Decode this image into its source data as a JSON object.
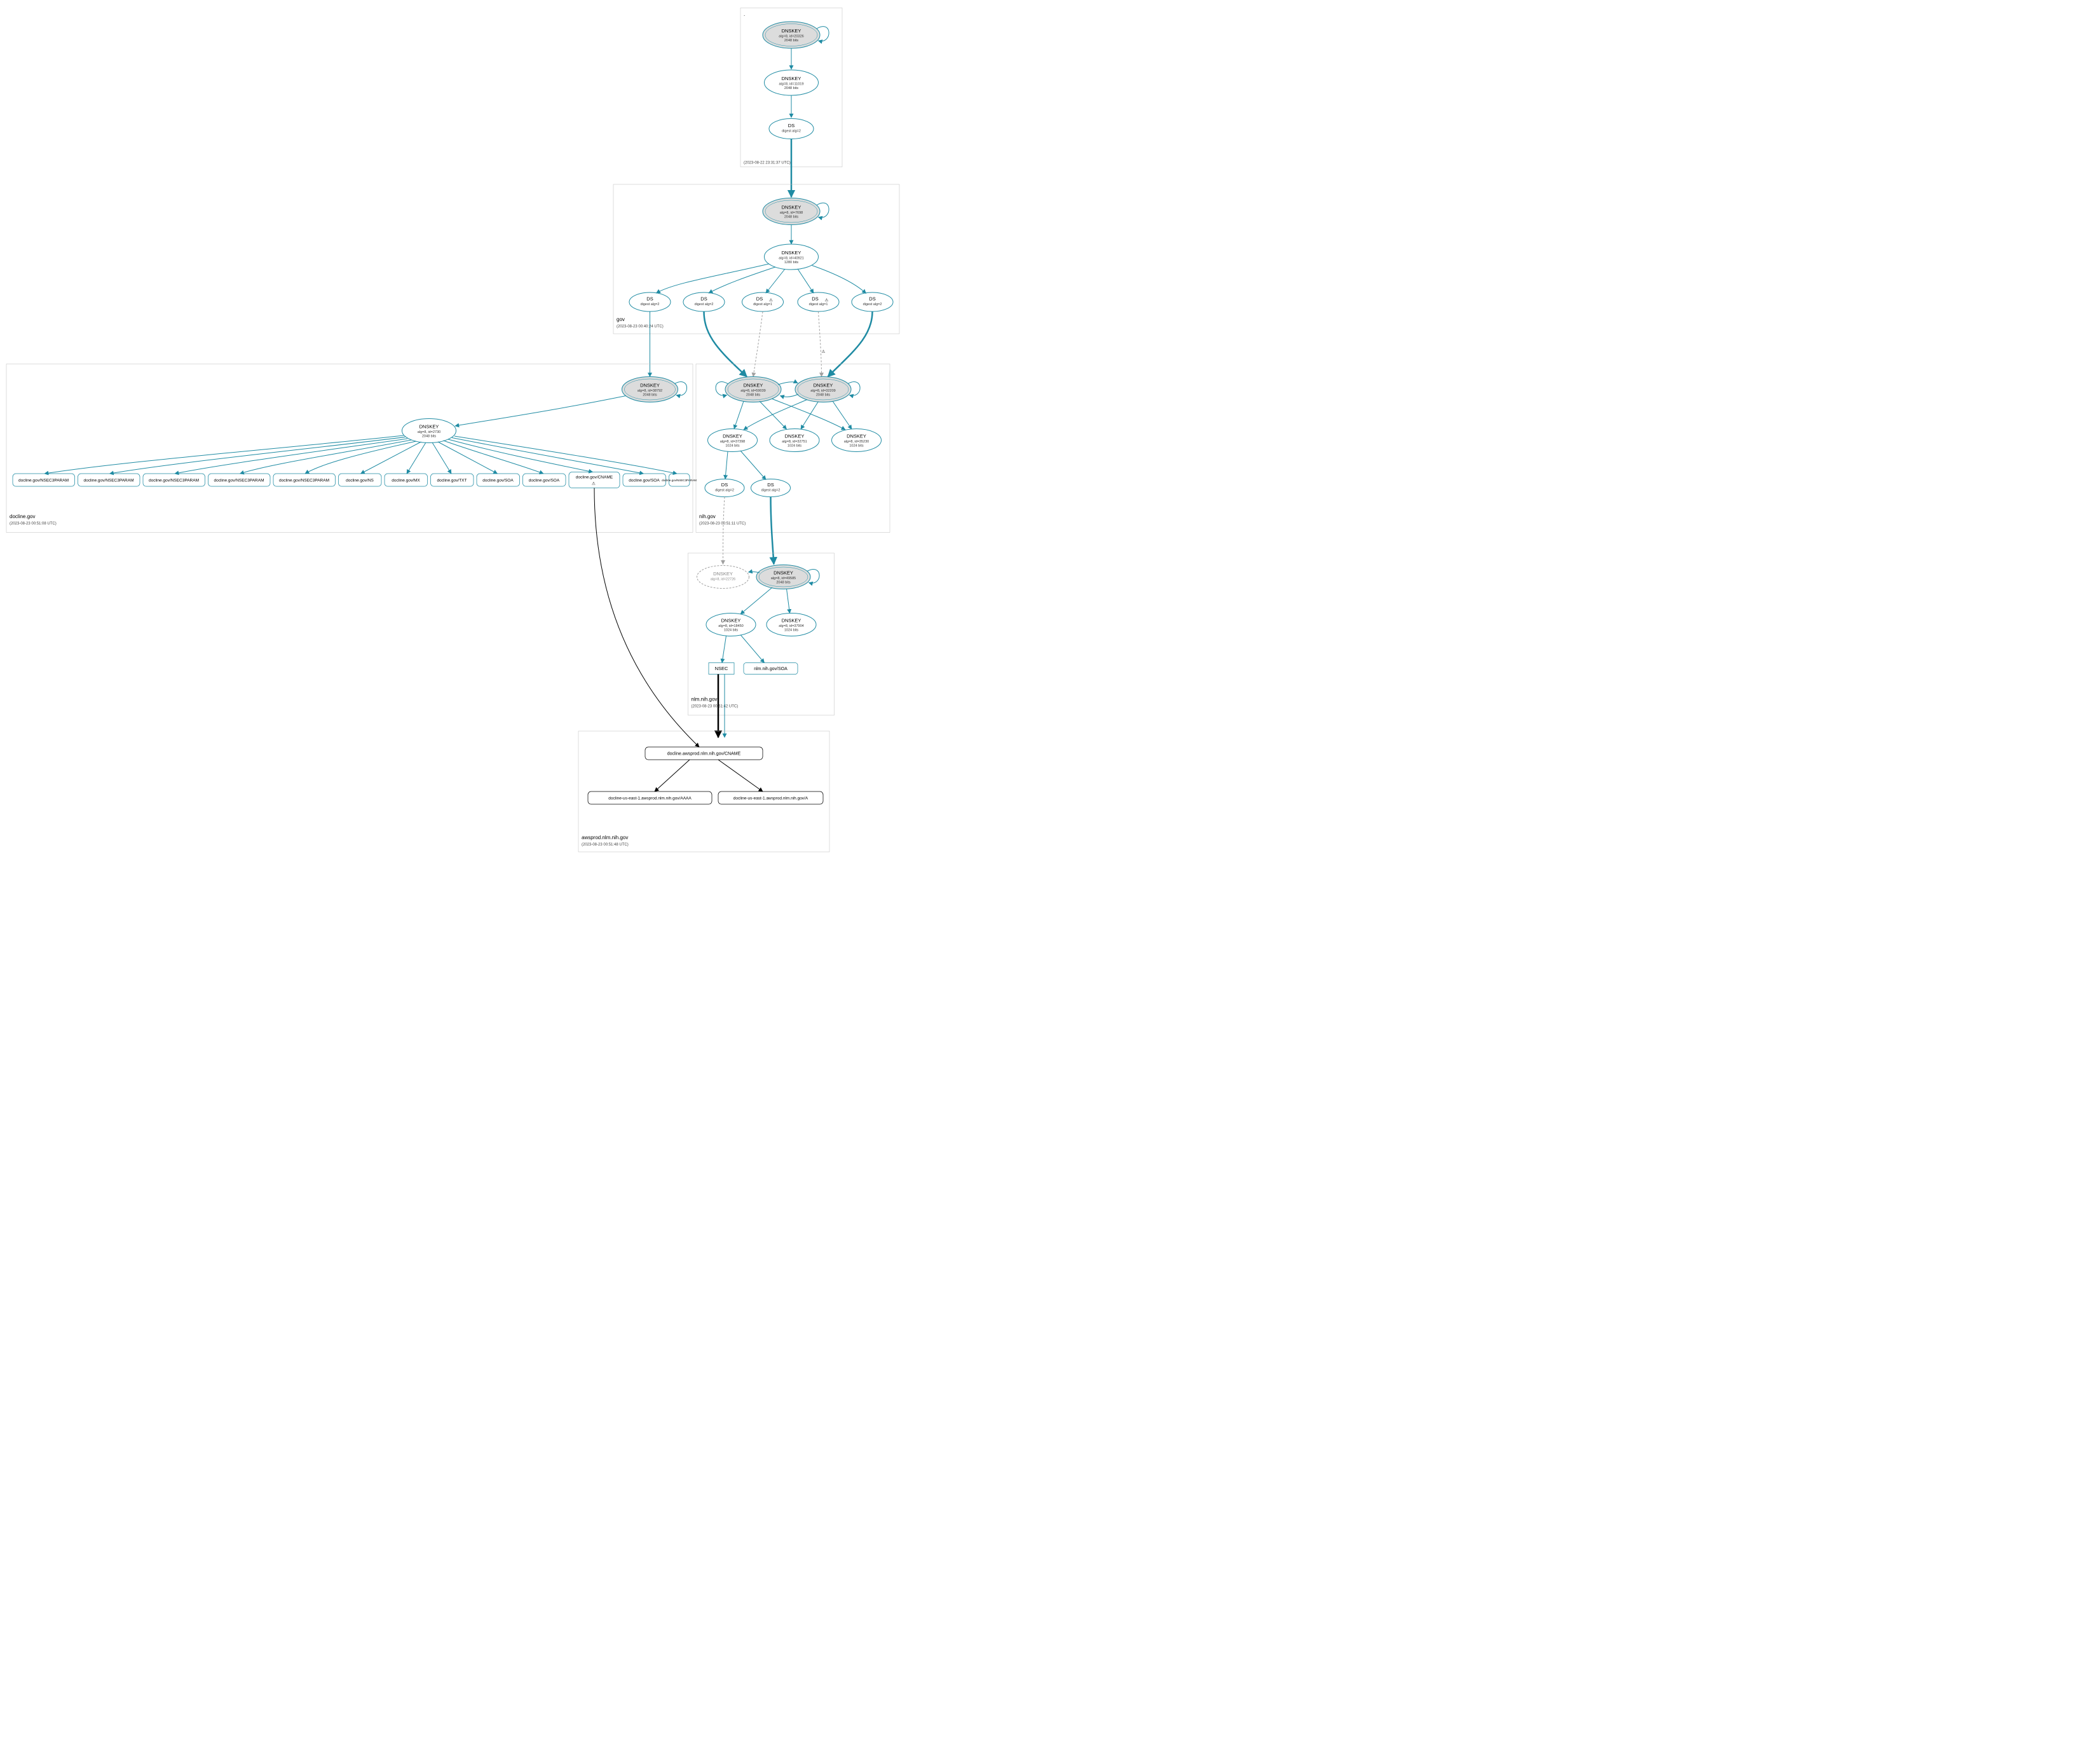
{
  "zones": {
    "root": {
      "label": ".",
      "timestamp": "(2023-08-22 23:31:37 UTC)",
      "nodes": {
        "ksk": {
          "type": "DNSKEY",
          "detail": "alg=8, id=20326",
          "bits": "2048 bits"
        },
        "zsk": {
          "type": "DNSKEY",
          "detail": "alg=8, id=11019",
          "bits": "2048 bits"
        },
        "ds": {
          "type": "DS",
          "detail": "digest alg=2"
        }
      }
    },
    "gov": {
      "label": "gov",
      "timestamp": "(2023-08-23 00:40:24 UTC)",
      "nodes": {
        "ksk": {
          "type": "DNSKEY",
          "detail": "alg=8, id=7698",
          "bits": "2048 bits"
        },
        "zsk": {
          "type": "DNSKEY",
          "detail": "alg=8, id=40921",
          "bits": "1280 bits"
        },
        "ds1": {
          "type": "DS",
          "detail": "digest alg=2"
        },
        "ds2": {
          "type": "DS",
          "detail": "digest alg=2"
        },
        "ds3": {
          "type": "DS",
          "detail": "digest alg=1",
          "warn": true
        },
        "ds4": {
          "type": "DS",
          "detail": "digest alg=1",
          "warn": true
        },
        "ds5": {
          "type": "DS",
          "detail": "digest alg=2"
        }
      }
    },
    "nih": {
      "label": "nih.gov",
      "timestamp": "(2023-08-23 00:51:11 UTC)",
      "nodes": {
        "ksk1": {
          "type": "DNSKEY",
          "detail": "alg=8, id=59039",
          "bits": "2048 bits"
        },
        "ksk2": {
          "type": "DNSKEY",
          "detail": "alg=8, id=32209",
          "bits": "2048 bits"
        },
        "zsk1": {
          "type": "DNSKEY",
          "detail": "alg=8, id=37398",
          "bits": "1024 bits"
        },
        "zsk2": {
          "type": "DNSKEY",
          "detail": "alg=8, id=32751",
          "bits": "1024 bits"
        },
        "zsk3": {
          "type": "DNSKEY",
          "detail": "alg=8, id=35230",
          "bits": "1024 bits"
        },
        "ds1": {
          "type": "DS",
          "detail": "digest alg=2"
        },
        "ds2": {
          "type": "DS",
          "detail": "digest alg=2"
        }
      }
    },
    "nlm": {
      "label": "nlm.nih.gov",
      "timestamp": "(2023-08-23 00:51:42 UTC)",
      "nodes": {
        "ksk_grey": {
          "type": "DNSKEY",
          "detail": "alg=8, id=22726"
        },
        "ksk": {
          "type": "DNSKEY",
          "detail": "alg=8, id=49585",
          "bits": "2048 bits"
        },
        "zsk1": {
          "type": "DNSKEY",
          "detail": "alg=8, id=18450",
          "bits": "1024 bits"
        },
        "zsk2": {
          "type": "DNSKEY",
          "detail": "alg=8, id=37904",
          "bits": "1024 bits"
        },
        "nsec": {
          "type": "NSEC"
        },
        "soa": {
          "type": "nlm.nih.gov/SOA"
        }
      }
    },
    "awsprod": {
      "label": "awsprod.nlm.nih.gov",
      "timestamp": "(2023-08-23 00:51:48 UTC)",
      "nodes": {
        "cname": {
          "type": "docline.awsprod.nlm.nih.gov/CNAME"
        },
        "aaaa": {
          "type": "docline-us-east-1.awsprod.nlm.nih.gov/AAAA"
        },
        "a": {
          "type": "docline-us-east-1.awsprod.nlm.nih.gov/A"
        }
      }
    },
    "docline": {
      "label": "docline.gov",
      "timestamp": "(2023-08-23 00:51:08 UTC)",
      "nodes": {
        "ksk": {
          "type": "DNSKEY",
          "detail": "alg=8, id=38792",
          "bits": "2048 bits"
        },
        "zsk": {
          "type": "DNSKEY",
          "detail": "alg=8, id=2730",
          "bits": "2048 bits"
        },
        "rr0": {
          "type": "docline.gov/NSEC3PARAM"
        },
        "rr1": {
          "type": "docline.gov/NSEC3PARAM"
        },
        "rr2": {
          "type": "docline.gov/NSEC3PARAM"
        },
        "rr3": {
          "type": "docline.gov/NSEC3PARAM"
        },
        "rr4": {
          "type": "docline.gov/NSEC3PARAM"
        },
        "rr5": {
          "type": "docline.gov/NS"
        },
        "rr6": {
          "type": "docline.gov/MX"
        },
        "rr7": {
          "type": "docline.gov/TXT"
        },
        "rr8": {
          "type": "docline.gov/SOA"
        },
        "rr9": {
          "type": "docline.gov/SOA"
        },
        "rr10": {
          "type": "docline.gov/CNAME",
          "warn": true
        },
        "rr11": {
          "type": "docline.gov/SOA"
        },
        "rr12": {
          "type": "docline.gov/NSEC3PARAM"
        }
      }
    }
  },
  "warn_icon": "⚠"
}
